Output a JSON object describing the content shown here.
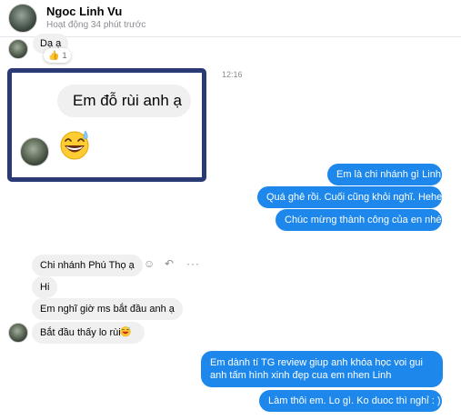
{
  "header": {
    "contact_name": "Ngoc Linh Vu",
    "status": "Hoạt động 34 phút trước"
  },
  "messages": {
    "da_a": "Dạ ạ",
    "reaction_count": "1",
    "timestamp": "12:16",
    "big_message": "Em đỗ rùi anh ạ",
    "out_1": "Em là chi nhánh gì Linh",
    "out_2": "Quá ghê rồi. Cuối cũng khỏi nghĩ. Hehe",
    "out_3": "Chúc mừng thành công của en nhé.",
    "in_1": "Chi nhánh Phú Thọ ạ",
    "in_2": "Hi",
    "in_3": "Em nghĩ giờ ms bắt đầu anh ạ",
    "in_4": "Bắt đầu thấy lo rùi",
    "out_4": "Em dành tí TG review giup anh khóa học voi gui anh tấm hình xinh đẹp cua em nhen Linh",
    "out_5": "Làm thôi em. Lo gì. Ko duoc thì nghỉ : )))"
  },
  "icons": {
    "reaction": "thumbs-up-icon",
    "emoji_big": "grinning-sweat-emoji",
    "emoji_small": "grinning-sweat-emoji",
    "actions": [
      "smile-icon",
      "reply-icon",
      "more-icon"
    ]
  },
  "colors": {
    "outgoing_bubble": "#1d87ec",
    "incoming_bubble": "#f0f0f0",
    "highlight_border": "#2a3a74"
  }
}
